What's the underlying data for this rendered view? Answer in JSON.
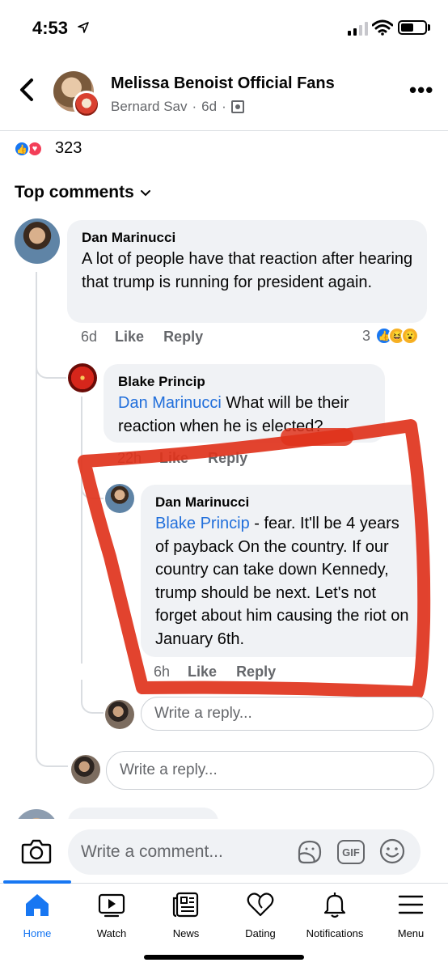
{
  "status_bar": {
    "time": "4:53"
  },
  "header": {
    "group_name": "Melissa Benoist Official Fans",
    "author": "Bernard Sav",
    "age": "6d",
    "separator": "·"
  },
  "reactions": {
    "count": "323"
  },
  "comments_section": {
    "title": "Top comments"
  },
  "comments": [
    {
      "author": "Dan Marinucci",
      "text": "A lot of people have that reaction after hearing that trump is running for president again.",
      "age": "6d",
      "like_label": "Like",
      "reply_label": "Reply",
      "reaction_count": "3"
    },
    {
      "author": "Blake Princip",
      "mention": "Dan Marinucci",
      "text": " What will be their reaction when he is elected?",
      "age": "22h",
      "like_label": "Like",
      "reply_label": "Reply"
    },
    {
      "author": "Dan Marinucci",
      "mention": "Blake Princip",
      "text": " - fear. It'll be 4 years of payback On the country. If our country can take down Kennedy, trump should be next. Let's not forget about him causing the riot on January 6th.",
      "age": "6h",
      "like_label": "Like",
      "reply_label": "Reply"
    }
  ],
  "reply_boxes": {
    "nested_placeholder": "Write a reply...",
    "thread_placeholder": "Write a reply..."
  },
  "composer": {
    "placeholder": "Write a comment...",
    "gif_label": "GIF"
  },
  "bottom_nav": {
    "items": [
      {
        "label": "Home",
        "icon": "home-icon",
        "active": true
      },
      {
        "label": "Watch",
        "icon": "watch-icon"
      },
      {
        "label": "News",
        "icon": "news-icon"
      },
      {
        "label": "Dating",
        "icon": "dating-icon"
      },
      {
        "label": "Notifications",
        "icon": "bell-icon"
      },
      {
        "label": "Menu",
        "icon": "menu-icon"
      }
    ],
    "active_color": "#1877f2"
  },
  "colors": {
    "accent": "#1877f2",
    "mention": "#216fdb",
    "annotation": "#e0331c",
    "bubble": "#f0f2f5"
  }
}
